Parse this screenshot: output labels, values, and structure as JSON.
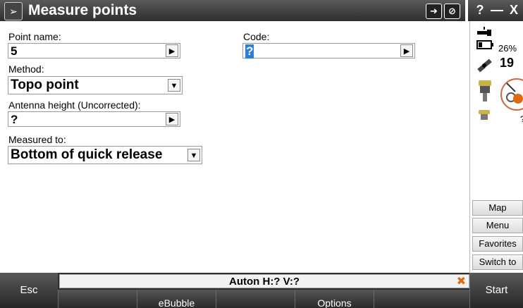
{
  "app": {
    "title": "Measure points"
  },
  "titlebar": {
    "help": "?",
    "minimize": "—",
    "close": "X"
  },
  "form": {
    "point_name": {
      "label": "Point name:",
      "value": "5"
    },
    "code": {
      "label": "Code:",
      "value": "?"
    },
    "method": {
      "label": "Method:",
      "value": "Topo point"
    },
    "antenna_height": {
      "label": "Antenna height (Uncorrected):",
      "value": "?"
    },
    "measured_to": {
      "label": "Measured to:",
      "value": "Bottom of quick release"
    }
  },
  "status_panel": {
    "battery": "26%",
    "satellites": "19",
    "radio": "?"
  },
  "side_menu": {
    "map": "Map",
    "menu": "Menu",
    "favorites": "Favorites",
    "switch_to": "Switch to"
  },
  "statusbar": {
    "text": "Auton H:? V:?"
  },
  "softkeys": {
    "esc": "Esc",
    "ebubble": "eBubble",
    "options": "Options",
    "start": "Start"
  },
  "icons": {
    "app": "measure-points-icon",
    "warning_color": "#e06a10"
  }
}
